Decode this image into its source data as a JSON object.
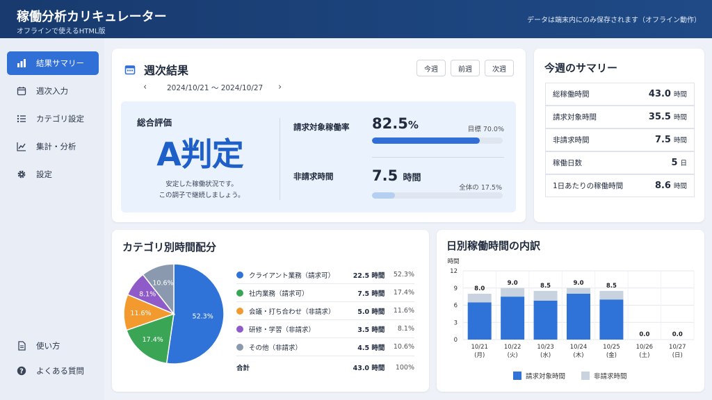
{
  "header": {
    "title": "稼働分析カリキュレーター",
    "subtitle": "オフラインで使えるHTML版",
    "note": "データは端末内にのみ保存されます（オフライン動作）"
  },
  "sidebar": {
    "items": [
      {
        "label": "結果サマリー",
        "icon": "bar-chart-icon",
        "active": true
      },
      {
        "label": "週次入力",
        "icon": "calendar-icon",
        "active": false
      },
      {
        "label": "カテゴリ設定",
        "icon": "list-icon",
        "active": false
      },
      {
        "label": "集計・分析",
        "icon": "line-chart-icon",
        "active": false
      },
      {
        "label": "設定",
        "icon": "gear-icon",
        "active": false
      }
    ],
    "bottom_items": [
      {
        "label": "使い方",
        "icon": "doc-icon"
      },
      {
        "label": "よくある質問",
        "icon": "help-icon"
      }
    ]
  },
  "weekly": {
    "title": "週次結果",
    "date_range": "2024/10/21 〜 2024/10/27",
    "buttons": {
      "this_week": "今週",
      "prev_week": "前週",
      "next_week": "次週"
    },
    "overall_label": "総合評価",
    "grade": "A判定",
    "message_line1": "安定した稼働状況です。",
    "message_line2": "この調子で継続しましょう。",
    "billable_rate_label": "請求対象稼働率",
    "billable_rate_value": "82.5",
    "billable_rate_unit": "%",
    "billable_rate_fraction": 0.825,
    "target_label": "目標 70.0%",
    "nonbillable_label": "非請求時間",
    "nonbillable_value": "7.5",
    "nonbillable_unit": "時間",
    "nonbillable_fraction": 0.175,
    "share_label": "全体の 17.5%"
  },
  "summary": {
    "title": "今週のサマリー",
    "rows": [
      {
        "label": "総稼働時間",
        "value": "43.0",
        "unit": "時間"
      },
      {
        "label": "請求対象時間",
        "value": "35.5",
        "unit": "時間"
      },
      {
        "label": "非請求時間",
        "value": "7.5",
        "unit": "時間"
      },
      {
        "label": "稼働日数",
        "value": "5",
        "unit": "日"
      },
      {
        "label": "1日あたりの稼働時間",
        "value": "8.6",
        "unit": "時間"
      }
    ]
  },
  "category": {
    "title": "カテゴリ別時間配分",
    "rows": [
      {
        "label": "クライアント業務（請求可）",
        "hours": "22.5 時間",
        "pct": "52.3%",
        "color": "#2f73d8"
      },
      {
        "label": "社内業務（請求可）",
        "hours": "7.5 時間",
        "pct": "17.4%",
        "color": "#3aa655"
      },
      {
        "label": "会議・打ち合わせ（非請求）",
        "hours": "5.0 時間",
        "pct": "11.6%",
        "color": "#f29a2e"
      },
      {
        "label": "研修・学習（非請求）",
        "hours": "3.5 時間",
        "pct": "8.1%",
        "color": "#8e5bc8"
      },
      {
        "label": "その他（非請求）",
        "hours": "4.5 時間",
        "pct": "10.6%",
        "color": "#8a99ad"
      }
    ],
    "total": {
      "label": "合計",
      "hours": "43.0 時間",
      "pct": "100%"
    }
  },
  "chart_data": [
    {
      "type": "pie",
      "title": "カテゴリ別時間配分",
      "categories": [
        "クライアント業務（請求可）",
        "社内業務（請求可）",
        "会議・打ち合わせ（非請求）",
        "研修・学習（非請求）",
        "その他（非請求）"
      ],
      "values": [
        52.3,
        17.4,
        11.6,
        8.1,
        10.6
      ],
      "labels": [
        "52.3%",
        "17.4%",
        "11.6%",
        "8.1%",
        "10.6%"
      ],
      "colors": [
        "#2f73d8",
        "#3aa655",
        "#f29a2e",
        "#8e5bc8",
        "#8a99ad"
      ]
    },
    {
      "type": "bar",
      "title": "日別稼働時間の内訳",
      "ylabel": "時間",
      "ylim": [
        0,
        12
      ],
      "yticks": [
        "0",
        "3",
        "6",
        "9",
        "12"
      ],
      "categories": [
        [
          "10/21",
          "(月)"
        ],
        [
          "10/22",
          "(火)"
        ],
        [
          "10/23",
          "(水)"
        ],
        [
          "10/24",
          "(木)"
        ],
        [
          "10/25",
          "(金)"
        ],
        [
          "10/26",
          "(土)"
        ],
        [
          "10/27",
          "(日)"
        ]
      ],
      "series": [
        {
          "name": "請求対象時間",
          "color": "#2f73d8",
          "values": [
            6.5,
            7.5,
            6.8,
            8.0,
            7.0,
            0,
            0
          ]
        },
        {
          "name": "非請求時間",
          "color": "#c9d3e0",
          "values": [
            1.5,
            1.5,
            1.7,
            1.0,
            1.5,
            0,
            0
          ]
        }
      ],
      "totals": [
        "8.0",
        "9.0",
        "8.5",
        "9.0",
        "8.5",
        "0.0",
        "0.0"
      ],
      "legend": "bottom"
    }
  ]
}
